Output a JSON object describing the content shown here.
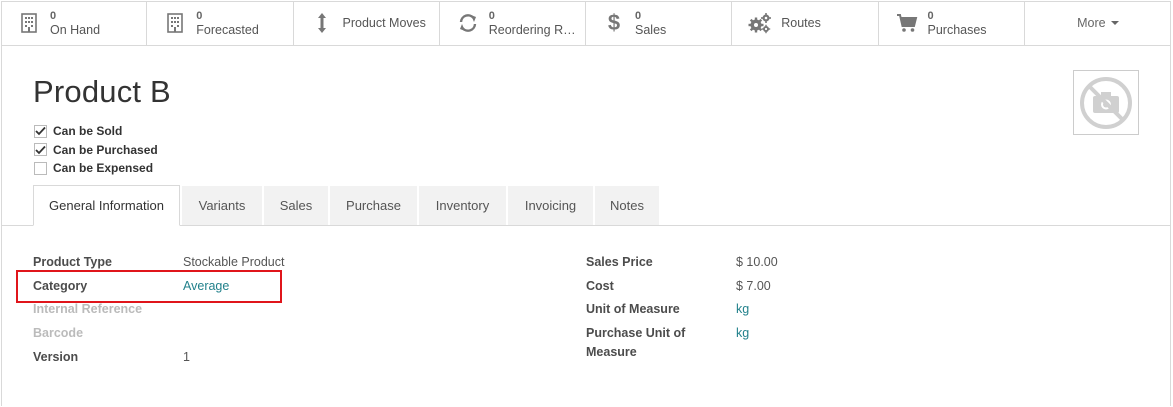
{
  "smart_buttons": [
    {
      "icon": "building-icon",
      "num": "0",
      "label": "On Hand"
    },
    {
      "icon": "building-icon",
      "num": "0",
      "label": "Forecasted"
    },
    {
      "icon": "arrows-vertical-icon",
      "num": "",
      "label": "Product Moves"
    },
    {
      "icon": "refresh-icon",
      "num": "0",
      "label": "Reordering Rules"
    },
    {
      "icon": "dollar-icon",
      "num": "0",
      "label": "Sales"
    },
    {
      "icon": "cogs-icon",
      "num": "",
      "label": "Routes"
    },
    {
      "icon": "cart-icon",
      "num": "0",
      "label": "Purchases"
    }
  ],
  "more_label": "More",
  "product": {
    "name": "Product B",
    "checkboxes": [
      {
        "label": "Can be Sold",
        "checked": true
      },
      {
        "label": "Can be Purchased",
        "checked": true
      },
      {
        "label": "Can be Expensed",
        "checked": false
      }
    ]
  },
  "tabs": [
    "General Information",
    "Variants",
    "Sales",
    "Purchase",
    "Inventory",
    "Invoicing",
    "Notes"
  ],
  "active_tab": "General Information",
  "left_fields": [
    {
      "label": "Product Type",
      "value": "Stockable Product"
    },
    {
      "label": "Category",
      "value": "Average"
    },
    {
      "label": "Internal Reference",
      "value": ""
    },
    {
      "label": "Barcode",
      "value": ""
    },
    {
      "label": "Version",
      "value": "1"
    }
  ],
  "right_fields": [
    {
      "label": "Sales Price",
      "value": "$ 10.00"
    },
    {
      "label": "Cost",
      "value": "$ 7.00"
    },
    {
      "label": "Unit of Measure",
      "value": "kg"
    },
    {
      "label_line1": "Purchase Unit of",
      "label_line2": "Measure",
      "value": "kg"
    }
  ],
  "colors": {
    "link": "#21818b",
    "highlight": "#e0151b"
  }
}
